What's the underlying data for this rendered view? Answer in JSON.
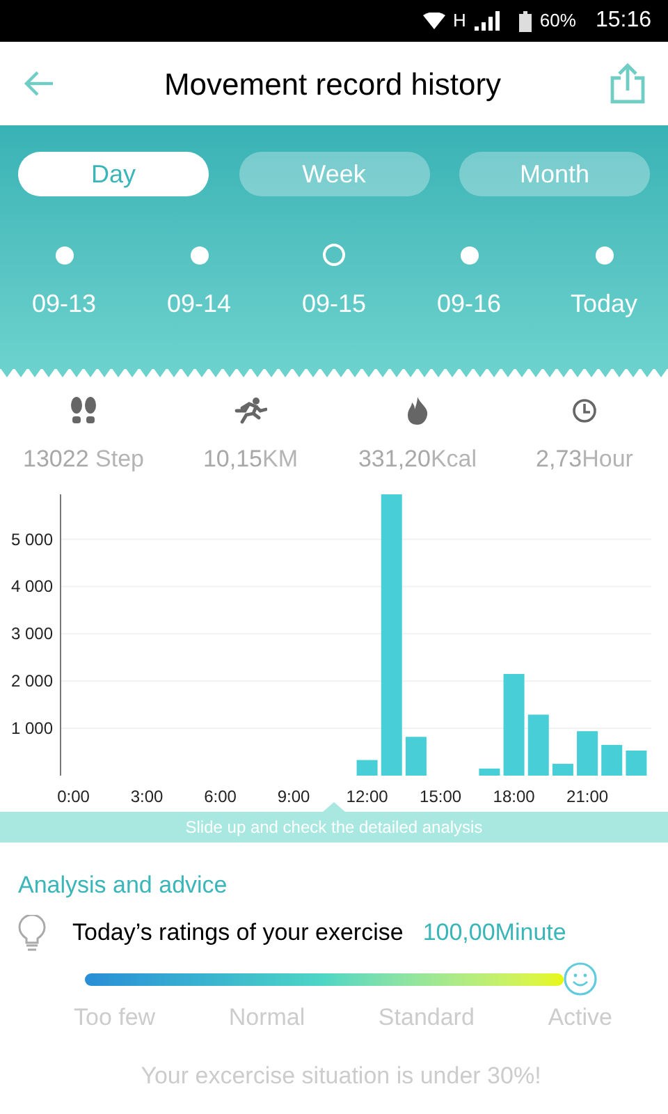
{
  "status_bar": {
    "network": "H",
    "battery": "60%",
    "time": "15:16"
  },
  "header": {
    "title": "Movement record history"
  },
  "tabs": [
    {
      "label": "Day",
      "selected": true
    },
    {
      "label": "Week",
      "selected": false
    },
    {
      "label": "Month",
      "selected": false
    }
  ],
  "dates": [
    {
      "label": "09-13",
      "selected": false
    },
    {
      "label": "09-14",
      "selected": false
    },
    {
      "label": "09-15",
      "selected": true
    },
    {
      "label": "09-16",
      "selected": false
    },
    {
      "label": "Today",
      "selected": false
    }
  ],
  "stats": [
    {
      "kind": "steps",
      "value": "13022",
      "unit": " Step"
    },
    {
      "kind": "distance",
      "value": "10,15",
      "unit": "KM"
    },
    {
      "kind": "calories",
      "value": "331,20",
      "unit": "Kcal"
    },
    {
      "kind": "time",
      "value": "2,73",
      "unit": "Hour"
    }
  ],
  "chart": {
    "chart_data": {
      "type": "bar",
      "grid": true,
      "x": [
        12,
        13,
        14,
        17,
        18,
        19,
        20,
        21,
        22,
        23
      ],
      "series": [
        {
          "color": "#48ced6",
          "values": [
            330,
            5950,
            820,
            150,
            2150,
            1290,
            250,
            940,
            650,
            530
          ]
        }
      ],
      "ylim": [
        0,
        5950
      ],
      "xlim": [
        -0.5,
        23.5
      ],
      "yticks": [
        {
          "value": 1000,
          "label": "1 000"
        },
        {
          "value": 2000,
          "label": "2 000"
        },
        {
          "value": 3000,
          "label": "3 000"
        },
        {
          "value": 4000,
          "label": "4 000"
        },
        {
          "value": 5000,
          "label": "5 000"
        }
      ],
      "xticks": [
        {
          "value": 0,
          "label": "0:00"
        },
        {
          "value": 3,
          "label": "3:00"
        },
        {
          "value": 6,
          "label": "6:00"
        },
        {
          "value": 9,
          "label": "9:00"
        },
        {
          "value": 12,
          "label": "12:00"
        },
        {
          "value": 15,
          "label": "15:00"
        },
        {
          "value": 18,
          "label": "18:00"
        },
        {
          "value": 21,
          "label": "21:00"
        }
      ]
    }
  },
  "hint": "Slide up and check the detailed analysis",
  "analysis": {
    "heading": "Analysis and advice",
    "rating_label": "Today’s ratings of your exercise",
    "rating_value": "100,00Minute",
    "level": 1,
    "scale_labels": [
      "Too few",
      "Normal",
      "Standard",
      "Active"
    ],
    "message": "Your excercise situation is under 30%!"
  }
}
